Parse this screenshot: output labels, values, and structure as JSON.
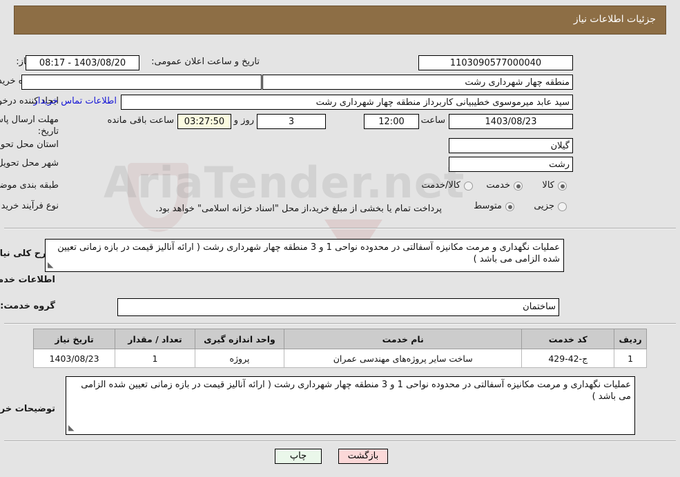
{
  "header": {
    "title": "جزئیات اطلاعات نیاز"
  },
  "watermark": {
    "text": "AriaTender.net"
  },
  "form": {
    "need_number_label": "شماره نیاز:",
    "need_number_value": "1103090577000040",
    "announce_datetime_label": "تاریخ و ساعت اعلان عمومی:",
    "announce_datetime_value": "1403/08/20 - 08:17",
    "buyer_org_label": "نام دستگاه خریدار:",
    "buyer_org_value": "منطقه چهار شهرداری رشت",
    "empty_field_value": "",
    "requester_label": "ایجاد کننده درخواست:",
    "requester_value": "سید عابد میرموسوی خطیبیانی کاربرداز منطقه چهار شهرداری رشت",
    "buyer_contact_link": "اطلاعات تماس خریدار",
    "deadline_label": "مهلت ارسال پاسخ: تا تاریخ:",
    "deadline_date": "1403/08/23",
    "hour_label": "ساعت",
    "deadline_time": "12:00",
    "days_value": "3",
    "days_label": "روز و",
    "countdown_value": "03:27:50",
    "remaining_label": "ساعت باقی مانده",
    "province_label": "استان محل تحویل:",
    "province_value": "گیلان",
    "city_label": "شهر محل تحویل:",
    "city_value": "رشت",
    "category_label": "طبقه بندی موضوعی:",
    "category_options": [
      {
        "label": "کالا",
        "selected": false
      },
      {
        "label": "خدمت",
        "selected": true
      },
      {
        "label": "کالا/خدمت",
        "selected": false
      }
    ],
    "process_label": "نوع فرآیند خرید :",
    "process_options": [
      {
        "label": "جزیی",
        "selected": false
      },
      {
        "label": "متوسط",
        "selected": true
      }
    ],
    "treasury_note": "پرداخت تمام یا بخشی از مبلغ خرید،از محل \"اسناد خزانه اسلامی\" خواهد بود."
  },
  "description": {
    "label": "شرح کلی نیاز:",
    "value": "عملیات نگهداری و مرمت مکانیزه آسفالتی در محدوده نواحی 1 و 3 منطقه چهار شهرداری رشت ( ارائه آنالیز قیمت در بازه زمانی تعیین شده الزامی می باشد )"
  },
  "services_section": {
    "heading": "اطلاعات خدمات مورد نیاز",
    "group_label": "گروه خدمت:",
    "group_value": "ساختمان"
  },
  "table": {
    "columns": [
      "ردیف",
      "کد خدمت",
      "نام خدمت",
      "واحد اندازه گیری",
      "تعداد / مقدار",
      "تاریخ نیاز"
    ],
    "rows": [
      {
        "row_no": "1",
        "service_code": "ج-42-429",
        "service_name": "ساخت سایر پروژه‌های مهندسی عمران",
        "unit": "پروژه",
        "quantity": "1",
        "need_date": "1403/08/23"
      }
    ]
  },
  "buyer_notes": {
    "label": "توضیحات خریدار:",
    "value": "عملیات نگهداری و مرمت مکانیزه آسفالتی در محدوده نواحی 1 و 3 منطقه چهار شهرداری رشت ( ارائه آنالیز قیمت در بازه زمانی تعیین شده الزامی می باشد )"
  },
  "footer": {
    "print_label": "چاپ",
    "back_label": "بازگشت"
  },
  "colors": {
    "header_bg": "#8d6e45",
    "link": "#1717d6",
    "countdown_bg": "#fbfbe0",
    "print_btn_bg": "#eaf7ea",
    "back_btn_bg": "#fbd8d8",
    "table_header_bg": "#cccccc"
  }
}
